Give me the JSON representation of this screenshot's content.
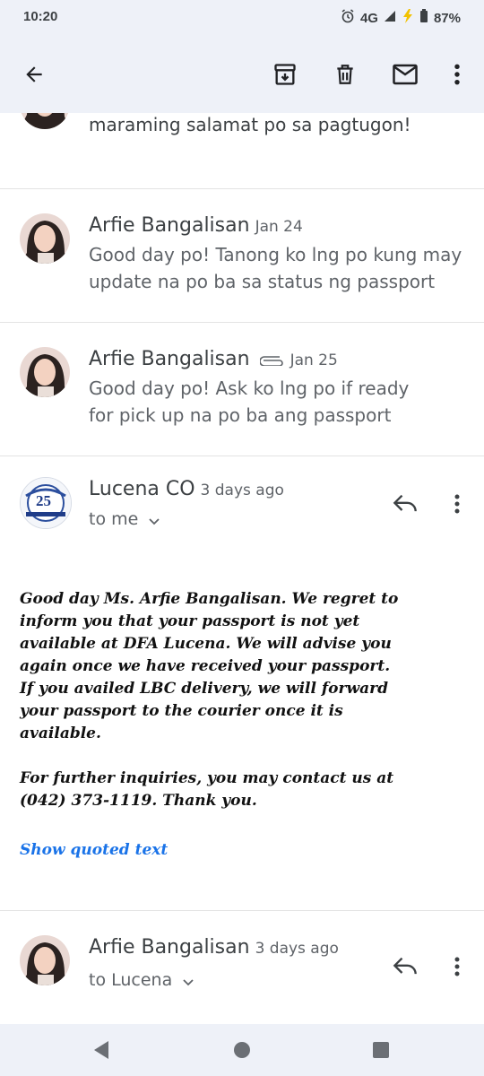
{
  "status": {
    "time": "10:20",
    "network": "4G",
    "battery": "87%"
  },
  "toolbar": {
    "back_icon": "arrow-back-icon",
    "archive_icon": "archive-icon",
    "delete_icon": "delete-icon",
    "mark_unread_icon": "mail-icon",
    "more_icon": "more-vert-icon"
  },
  "thread": {
    "top_snippet": "maraming salamat po sa pagtugon!",
    "messages": [
      {
        "sender": "Arfie Bangalisan",
        "date": "Jan 24",
        "snippet_line1": "Good day po! Tanong ko lng po kung may",
        "snippet_line2": "update na po ba sa status ng passport"
      },
      {
        "sender": "Arfie Bangalisan",
        "date": "Jan 25",
        "has_attachment": true,
        "snippet_line1": "Good day po! Ask ko lng po if ready",
        "snippet_line2": "for pick up na po ba ang passport"
      }
    ],
    "expanded": {
      "sender": "Lucena CO",
      "date": "3 days ago",
      "recipient": "to me",
      "body_lines": [
        "Good day Ms. Arfie Bangalisan. We regret to",
        "inform you that your passport is not yet",
        "available at DFA Lucena. We will advise you",
        "again once we have received your passport.",
        "If you availed LBC delivery, we will forward",
        "your passport to the courier once it is",
        "available."
      ],
      "body2_lines": [
        "For further inquiries, you may contact us at",
        "(042) 373-1119. Thank you."
      ],
      "show_quoted": "Show quoted text",
      "logo_number": "25"
    },
    "last": {
      "sender": "Arfie Bangalisan",
      "date": "3 days ago",
      "recipient": "to Lucena"
    }
  },
  "colors": {
    "bar_bg": "#eef1f8",
    "link": "#1a73e8"
  }
}
